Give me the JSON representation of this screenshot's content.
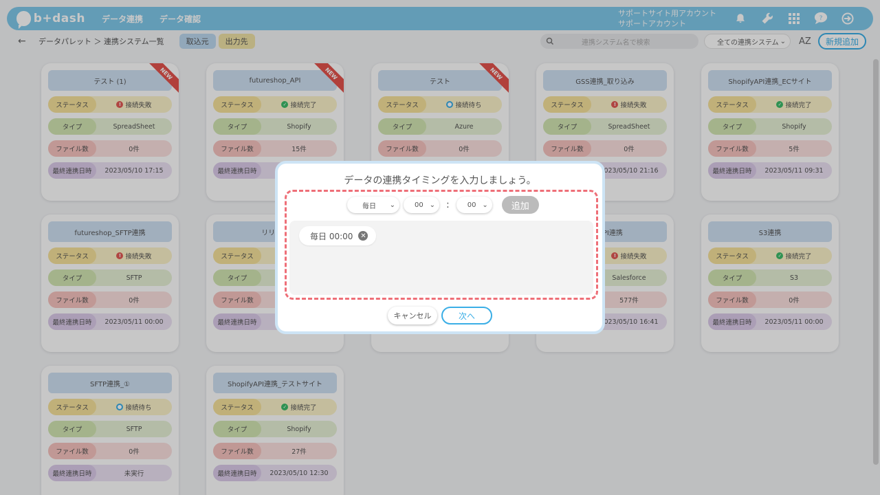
{
  "header": {
    "logo_text": "b+dash",
    "nav": [
      "データ連携",
      "データ確認"
    ],
    "account_line1": "サポートサイト用アカウント",
    "account_line2": "サポートアカウント"
  },
  "toolbar": {
    "back_icon": "←",
    "breadcrumb": "データパレット ＞ 連携システム一覧",
    "tab_in": "取込元",
    "tab_out": "出力先",
    "search_placeholder": "連携システム名で検索",
    "filter_value": "全ての連携システム",
    "sort_label": "AZ",
    "new_button": "新規追加"
  },
  "labels": {
    "status": "ステータス",
    "type": "タイプ",
    "files": "ファイル数",
    "last": "最終連携日時",
    "new_ribbon": "NEW"
  },
  "cards": [
    {
      "title": "テスト (1)",
      "status": "接続失敗",
      "status_kind": "fail",
      "type": "SpreadSheet",
      "files": "0件",
      "last": "2023/05/10 17:15",
      "is_new": true
    },
    {
      "title": "futureshop_API",
      "status": "接続完了",
      "status_kind": "ok",
      "type": "Shopify",
      "files": "15件",
      "last": "",
      "is_new": true
    },
    {
      "title": "テスト",
      "status": "接続待ち",
      "status_kind": "wait",
      "type": "Azure",
      "files": "0件",
      "last": "",
      "is_new": true
    },
    {
      "title": "GSS連携_取り込み",
      "status": "接続失敗",
      "status_kind": "fail",
      "type": "SpreadSheet",
      "files": "0件",
      "last": "2023/05/10 21:16",
      "is_new": false
    },
    {
      "title": "ShopifyAPI連携_ECサイト",
      "status": "接続完了",
      "status_kind": "ok",
      "type": "Shopify",
      "files": "5件",
      "last": "2023/05/11 09:31",
      "is_new": false
    },
    {
      "title": "futureshop_SFTP連携",
      "status": "接続失敗",
      "status_kind": "fail",
      "type": "SFTP",
      "files": "0件",
      "last": "2023/05/11 00:00",
      "is_new": false
    },
    {
      "title": "リリース",
      "status": "",
      "status_kind": "none",
      "type": "",
      "files": "",
      "last": "20",
      "is_new": false
    },
    {
      "title": "",
      "status": "",
      "status_kind": "none",
      "type": "",
      "files": "",
      "last": "",
      "is_new": false
    },
    {
      "title": "ud API連携",
      "status": "接続失敗",
      "status_kind": "fail",
      "type": "Salesforce",
      "files": "577件",
      "last": "2023/05/10 16:41",
      "is_new": false
    },
    {
      "title": "S3連携",
      "status": "接続完了",
      "status_kind": "ok",
      "type": "S3",
      "files": "0件",
      "last": "2023/05/11 00:00",
      "is_new": false
    },
    {
      "title": "SFTP連携_①",
      "status": "接続待ち",
      "status_kind": "wait",
      "type": "SFTP",
      "files": "0件",
      "last": "未実行",
      "is_new": false
    },
    {
      "title": "ShopifyAPI連携_テストサイト",
      "status": "接続完了",
      "status_kind": "ok",
      "type": "Shopify",
      "files": "27件",
      "last": "2023/05/10 12:30",
      "is_new": false
    }
  ],
  "modal": {
    "title": "データの連携タイミングを入力しましょう。",
    "frequency": "毎日",
    "hour": "00",
    "colon": ":",
    "minute": "00",
    "add_button": "追加",
    "chip_text": "毎日 00:00",
    "cancel_button": "キャンセル",
    "next_button": "次へ"
  },
  "colors": {
    "accent": "#3aaee6",
    "header": "#7fc8ea",
    "dashed": "#ee6f78"
  }
}
